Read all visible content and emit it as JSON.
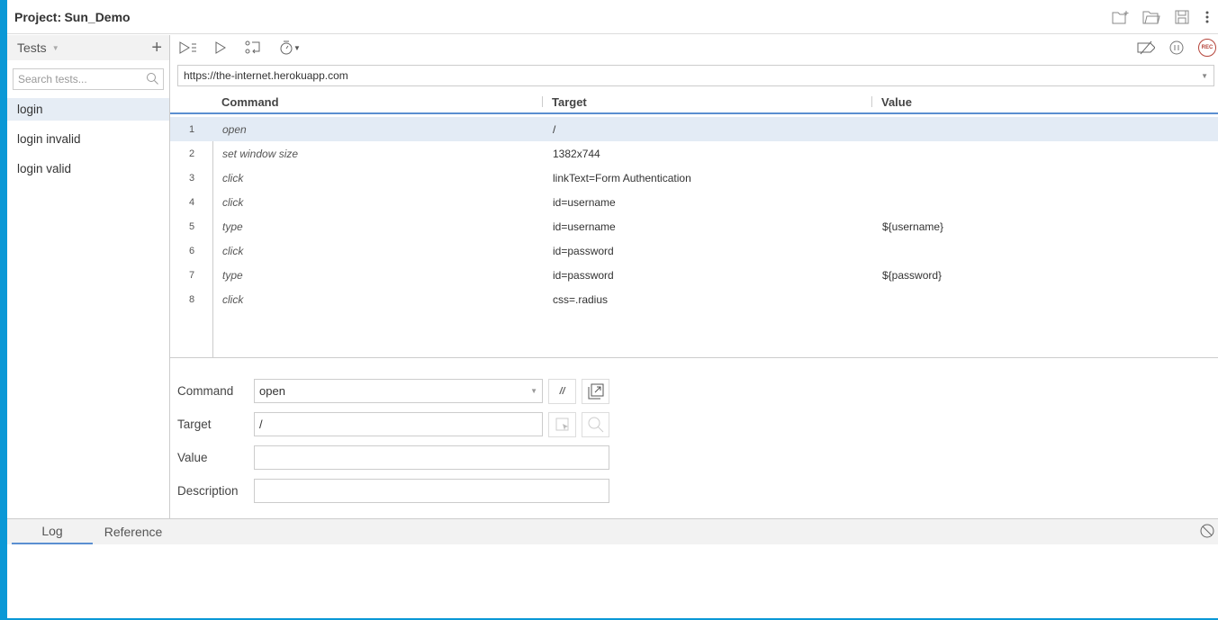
{
  "header": {
    "project_label": "Project:",
    "project_name": "Sun_Demo"
  },
  "sidebar": {
    "title": "Tests",
    "search_placeholder": "Search tests...",
    "items": [
      {
        "label": "login"
      },
      {
        "label": "login invalid"
      },
      {
        "label": "login valid"
      }
    ],
    "selected": "login"
  },
  "url": "https://the-internet.herokuapp.com",
  "table": {
    "headers": [
      "Command",
      "Target",
      "Value"
    ],
    "rows": [
      {
        "n": "1",
        "command": "open",
        "target": "/",
        "value": ""
      },
      {
        "n": "2",
        "command": "set window size",
        "target": "1382x744",
        "value": ""
      },
      {
        "n": "3",
        "command": "click",
        "target": "linkText=Form Authentication",
        "value": ""
      },
      {
        "n": "4",
        "command": "click",
        "target": "id=username",
        "value": ""
      },
      {
        "n": "5",
        "command": "type",
        "target": "id=username",
        "value": "${username}"
      },
      {
        "n": "6",
        "command": "click",
        "target": "id=password",
        "value": ""
      },
      {
        "n": "7",
        "command": "type",
        "target": "id=password",
        "value": "${password}"
      },
      {
        "n": "8",
        "command": "click",
        "target": "css=.radius",
        "value": ""
      }
    ]
  },
  "editor": {
    "command_label": "Command",
    "command_value": "open",
    "target_label": "Target",
    "target_value": "/",
    "value_label": "Value",
    "value_value": "",
    "description_label": "Description",
    "description_value": "",
    "comment_btn": "//"
  },
  "bottom": {
    "tabs": [
      "Log",
      "Reference"
    ],
    "active": "Log"
  },
  "record_label": "REC",
  "colors": {
    "accent": "#5b8fd1",
    "record": "#b5443a",
    "desktop": "#0a98d6"
  }
}
